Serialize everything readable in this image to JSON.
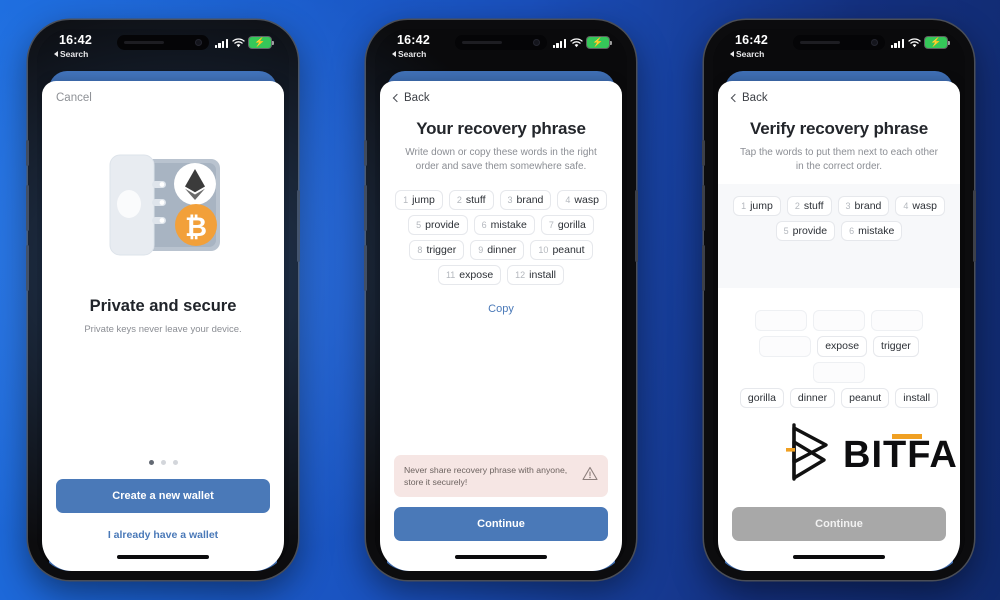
{
  "background": {
    "color_left": "#1f6fe0",
    "color_right": "#102a6e"
  },
  "watermark": {
    "brand": "BITFA",
    "accent_color": "#f0a022"
  },
  "phones": [
    {
      "id": "onboarding",
      "status_bar": {
        "time": "16:42",
        "back_label": "Search",
        "signal": "signal-icon",
        "wifi": "wifi-icon",
        "battery": "battery-charging-icon"
      },
      "nav": {
        "left_label": "Cancel"
      },
      "illustration": "safe-with-crypto-coins-icon",
      "hero_title": "Private and secure",
      "hero_subtitle": "Private keys never leave your device.",
      "pager": {
        "count": 3,
        "active": 1
      },
      "primary_button": "Create a new wallet",
      "secondary_link": "I already have a wallet"
    },
    {
      "id": "recovery-phrase",
      "status_bar": {
        "time": "16:42",
        "back_label": "Search"
      },
      "nav": {
        "back_label": "Back"
      },
      "title": "Your recovery phrase",
      "subtitle": "Write down or copy these words in the right order and save them somewhere safe.",
      "words": [
        {
          "index": "1",
          "word": "jump"
        },
        {
          "index": "2",
          "word": "stuff"
        },
        {
          "index": "3",
          "word": "brand"
        },
        {
          "index": "4",
          "word": "wasp"
        },
        {
          "index": "5",
          "word": "provide"
        },
        {
          "index": "6",
          "word": "mistake"
        },
        {
          "index": "7",
          "word": "gorilla"
        },
        {
          "index": "8",
          "word": "trigger"
        },
        {
          "index": "9",
          "word": "dinner"
        },
        {
          "index": "10",
          "word": "peanut"
        },
        {
          "index": "11",
          "word": "expose"
        },
        {
          "index": "12",
          "word": "install"
        }
      ],
      "copy_label": "Copy",
      "warning": "Never share recovery phrase with anyone, store it securely!",
      "primary_button": "Continue"
    },
    {
      "id": "verify-phrase",
      "status_bar": {
        "time": "16:42",
        "back_label": "Search"
      },
      "nav": {
        "back_label": "Back"
      },
      "title": "Verify recovery phrase",
      "subtitle": "Tap the words to put them next to each other in the correct order.",
      "selected_words": [
        {
          "index": "1",
          "word": "jump"
        },
        {
          "index": "2",
          "word": "stuff"
        },
        {
          "index": "3",
          "word": "brand"
        },
        {
          "index": "4",
          "word": "wasp"
        },
        {
          "index": "5",
          "word": "provide"
        },
        {
          "index": "6",
          "word": "mistake"
        }
      ],
      "bank_rows": [
        [
          {
            "word": "",
            "used": true
          },
          {
            "word": "",
            "used": true
          },
          {
            "word": "",
            "used": true
          }
        ],
        [
          {
            "word": "",
            "used": true
          },
          {
            "word": "expose",
            "used": false
          },
          {
            "word": "trigger",
            "used": false
          },
          {
            "word": "",
            "used": true
          }
        ],
        [
          {
            "word": "gorilla",
            "used": false
          },
          {
            "word": "dinner",
            "used": false
          },
          {
            "word": "peanut",
            "used": false
          },
          {
            "word": "install",
            "used": false
          }
        ]
      ],
      "primary_button": "Continue",
      "primary_button_state": "disabled"
    }
  ]
}
